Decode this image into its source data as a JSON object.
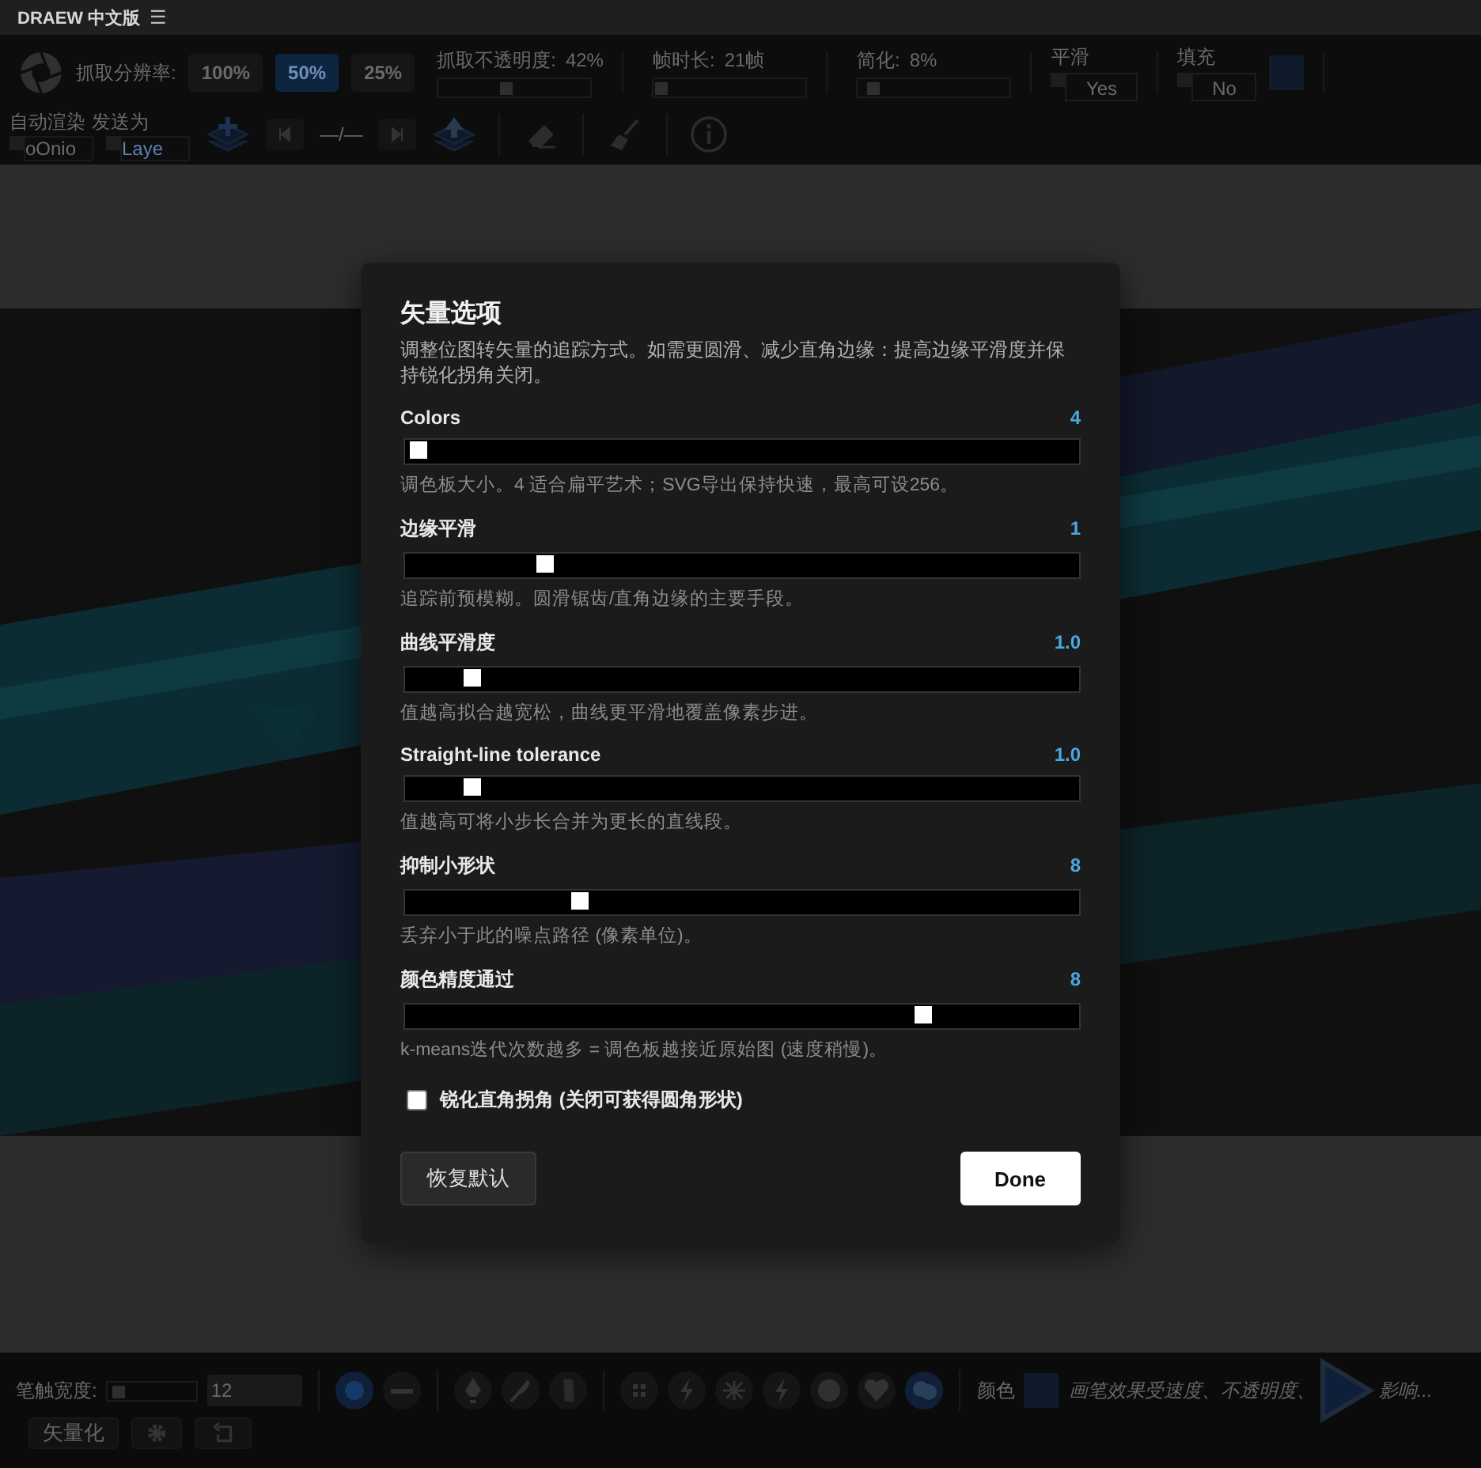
{
  "app_bar": {
    "title": "DRAEW 中文版",
    "menu_icon": "☰"
  },
  "toolbar": {
    "capture_label": "抓取分辨率:",
    "resolutions": [
      {
        "label": "100%",
        "selected": false
      },
      {
        "label": "50%",
        "selected": true
      },
      {
        "label": "25%",
        "selected": false
      }
    ],
    "sliders": [
      {
        "label": "抓取不透明度:",
        "reading": "42%",
        "level": 0.45
      },
      {
        "label": "帧时长:",
        "reading": "21帧",
        "level": 0.05
      },
      {
        "label": "简化:",
        "reading": "8%",
        "level": 0.1
      }
    ],
    "toggles": [
      {
        "label": "平滑",
        "value": "Yes",
        "checked": false
      },
      {
        "label": "填充",
        "value": "No",
        "checked": false
      }
    ],
    "auto_render_label": "自动渲染",
    "send_as_label": "发送为",
    "send_options": [
      {
        "value": "oOnio",
        "checked": false
      },
      {
        "value": "Laye",
        "checked": false
      }
    ],
    "frame_counter": "—/—"
  },
  "bottom_bar": {
    "stroke_label": "笔触宽度:",
    "stroke_width": {
      "level": 0.12,
      "value": "12"
    },
    "shape_tools": [
      {
        "kind": "dot",
        "selected": true
      },
      {
        "kind": "line",
        "selected": false
      }
    ],
    "pen_tools": [
      {
        "kind": "nib",
        "selected": false
      },
      {
        "kind": "feather",
        "selected": false
      },
      {
        "kind": "marker",
        "selected": false
      }
    ],
    "effects": [
      {
        "kind": "grid",
        "selected": false
      },
      {
        "kind": "bolt",
        "selected": false
      },
      {
        "kind": "splat",
        "selected": false
      },
      {
        "kind": "bolt",
        "selected": false
      },
      {
        "kind": "ball",
        "selected": false
      },
      {
        "kind": "blob",
        "selected": false
      },
      {
        "kind": "cloud",
        "selected": true
      }
    ],
    "color_label": "颜色",
    "hint": "画笔效果受速度、不透明度、",
    "hint_tail": "影响...",
    "vectorize_button": "矢量化"
  },
  "dialog": {
    "title": "矢量选项",
    "description": "调整位图转矢量的追踪方式。如需更圆滑、减少直角边缘：提高边缘平滑度并保持锐化拐角关闭。",
    "settings": [
      {
        "label": "Colors",
        "reading": "4",
        "level": 0.02,
        "help": "调色板大小。4 适合扁平艺术；SVG导出保持快速，最高可设256。"
      },
      {
        "label": "边缘平滑",
        "reading": "1",
        "level": 0.21,
        "help": "追踪前预模糊。圆滑锯齿/直角边缘的主要手段。"
      },
      {
        "label": "曲线平滑度",
        "reading": "1.0",
        "level": 0.1,
        "help": "值越高拟合越宽松，曲线更平滑地覆盖像素步进。"
      },
      {
        "label": "Straight-line tolerance",
        "reading": "1.0",
        "level": 0.1,
        "help": "值越高可将小步长合并为更长的直线段。"
      },
      {
        "label": "抑制小形状",
        "reading": "8",
        "level": 0.26,
        "help": "丢弃小于此的噪点路径 (像素单位)。"
      },
      {
        "label": "颜色精度通过",
        "reading": "8",
        "level": 0.77,
        "help": "k-means迭代次数越多 = 调色板越接近原始图 (速度稍慢)。"
      }
    ],
    "sharp_corners": {
      "label": "锐化直角拐角 (关闭可获得圆角形状)",
      "checked": false
    },
    "reset_button": "恢复默认",
    "done_button": "Done"
  }
}
